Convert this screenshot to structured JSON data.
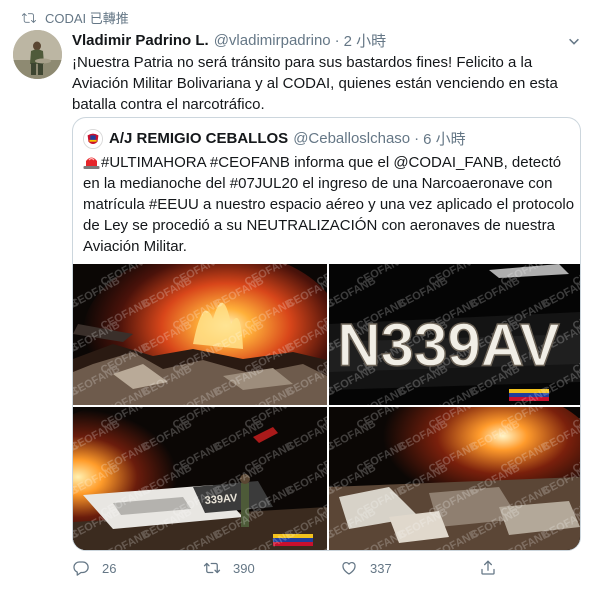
{
  "retweet_context": {
    "label": "CODAI 已轉推",
    "icon": "retweet-icon"
  },
  "tweet": {
    "author_name": "Vladimir Padrino L.",
    "author_handle": "@vladimirpadrino",
    "separator": "·",
    "time": "2 小時",
    "text": "¡Nuestra Patria no será tránsito para sus bastardos fines! Felicito a la Aviación Militar Bolivariana y al CODAI, quienes están venciendo en esta batalla contra el narcotráfico."
  },
  "quoted_tweet": {
    "author_name": "A/J REMIGIO CEBALLOS",
    "author_handle": "@Ceballoslchaso",
    "separator": "·",
    "time": "6 小時",
    "text": "#ULTIMAHORA #CEOFANB informa que el @CODAI_FANB, detectó en la medianoche del #07JUL20 el ingreso de una Narcoaeronave con matrícula #EEUU a nuestro espacio aéreo y una vez aplicado el protocolo de Ley se procedió a su NEUTRALIZACIÓN con aeronaves de nuestra Aviación Militar.",
    "photos": [
      {
        "name": "photo-burning-wreckage",
        "watermark": "CEOFANB"
      },
      {
        "name": "photo-tail-number",
        "watermark": "CEOFANB",
        "tail_number": "N339AV"
      },
      {
        "name": "photo-wreck-with-soldier",
        "watermark": "CEOFANB",
        "fuselage_text": "339AV"
      },
      {
        "name": "photo-wreck-fire-aerial",
        "watermark": "CEOFANB"
      }
    ]
  },
  "actions": {
    "reply_count": "26",
    "retweet_count": "390",
    "like_count": "337"
  },
  "colors": {
    "secondary_text": "#657786",
    "border": "#ccd6dd",
    "primary_text": "#14171a",
    "flag_yellow": "#f4c400",
    "flag_blue": "#1f3d9b",
    "flag_red": "#d5182b"
  }
}
